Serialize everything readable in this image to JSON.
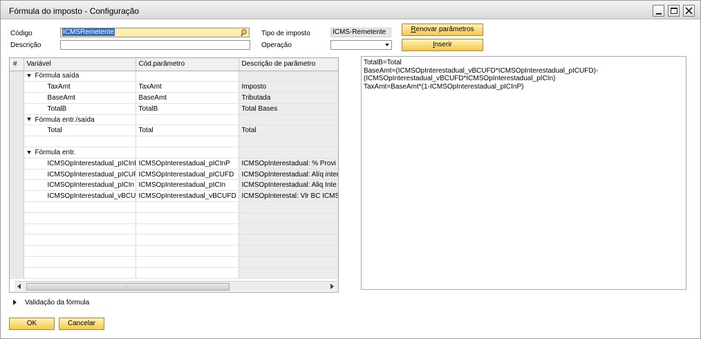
{
  "window": {
    "title": "Fórmula do imposto - Configuração"
  },
  "header": {
    "codigo_label": "Código",
    "codigo_value": "ICMSRemetente",
    "descricao_label": "Descrição",
    "descricao_value": "",
    "tipo_label": "Tipo de imposto",
    "tipo_value": "ICMS-Remetente",
    "operacao_label": "Operação",
    "operacao_value": ""
  },
  "buttons": {
    "renovar_prefix": "R",
    "renovar_rest": "enovar parâmetros",
    "inserir_prefix": "I",
    "inserir_rest": "nserir",
    "ok": "OK",
    "cancel": "Cancelar"
  },
  "grid": {
    "columns": [
      "#",
      "Variável",
      "Cód.parâmetro",
      "Descrição de parâmetro"
    ],
    "rows": [
      {
        "type": "group",
        "name": "Fórmula saída"
      },
      {
        "type": "item",
        "var": "TaxAmt",
        "cod": "TaxAmt",
        "desc": "Imposto"
      },
      {
        "type": "item",
        "var": "BaseAmt",
        "cod": "BaseAmt",
        "desc": "Tributada"
      },
      {
        "type": "item",
        "var": "TotalB",
        "cod": "TotalB",
        "desc": "Total Bases"
      },
      {
        "type": "group",
        "name": "Fórmula entr./saída"
      },
      {
        "type": "item",
        "var": "Total",
        "cod": "Total",
        "desc": "Total"
      },
      {
        "type": "empty"
      },
      {
        "type": "group",
        "name": "Fórmula entr."
      },
      {
        "type": "item",
        "var": "ICMSOpInterestadual_pICInP",
        "cod": "ICMSOpInterestadual_pICInP",
        "desc": "ICMSOpInterestadual: % Provi"
      },
      {
        "type": "item",
        "var": "ICMSOpInterestadual_pICUFD",
        "cod": "ICMSOpInterestadual_pICUFD",
        "desc": "ICMSOpInterestadual: Alíq inter"
      },
      {
        "type": "item",
        "var": "ICMSOpInterestadual_pICIn",
        "cod": "ICMSOpInterestadual_pICIn",
        "desc": "ICMSOpInterestadual: Aliq Inte"
      },
      {
        "type": "item",
        "var": "ICMSOpInterestadual_vBCUFD",
        "cod": "ICMSOpInterestadual_vBCUFD",
        "desc": "ICMSOpInterestal: Vlr BC ICMS"
      },
      {
        "type": "empty"
      },
      {
        "type": "empty"
      },
      {
        "type": "empty"
      },
      {
        "type": "empty"
      },
      {
        "type": "empty"
      },
      {
        "type": "empty"
      },
      {
        "type": "empty"
      }
    ]
  },
  "formula_text": "TotalB=Total\nBaseAmt=(ICMSOpInterestadual_vBCUFD*ICMSOpInterestadual_pICUFD)-\n(ICMSOpInterestadual_vBCUFD*ICMSOpInterestadual_pICIn)\nTaxAmt=BaseAmt*(1-ICMSOpInterestadual_pICInP)",
  "validation": {
    "label": "Validação da fórmula"
  }
}
